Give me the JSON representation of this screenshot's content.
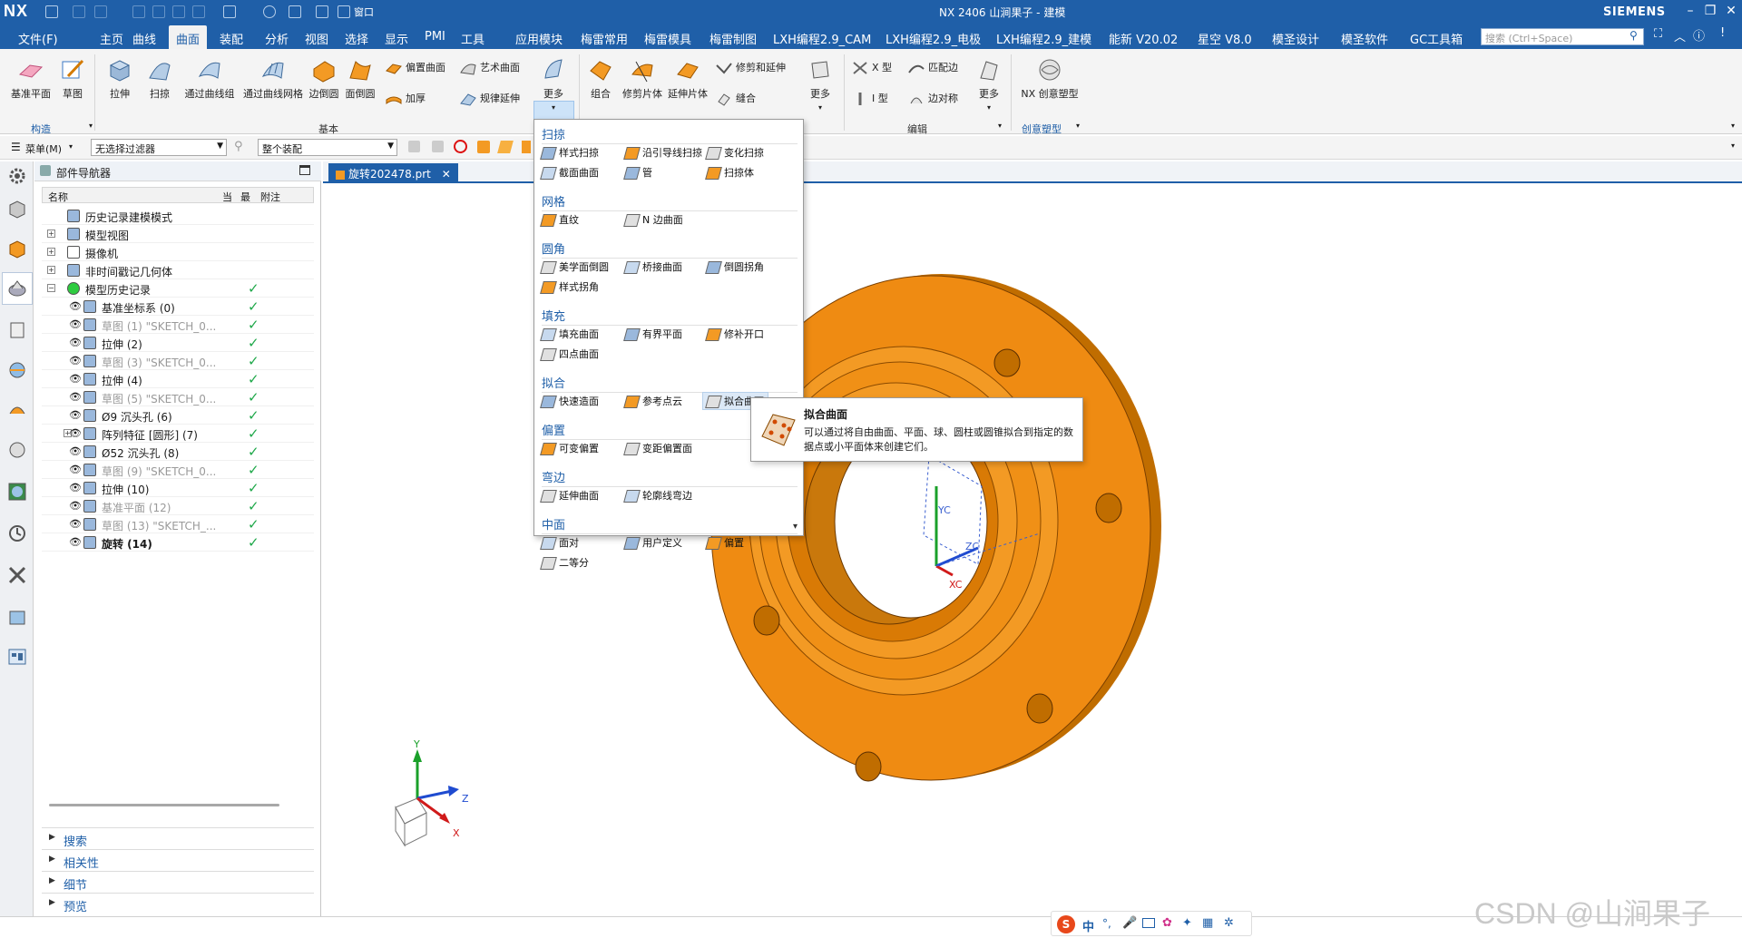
{
  "app": {
    "logo": "NX",
    "window_title": "NX 2406 山涧果子 - 建模",
    "brand": "SIEMENS",
    "window_label": "窗口"
  },
  "menubar": {
    "items": [
      "文件(F)",
      "主页",
      "曲线",
      "曲面",
      "装配",
      "分析",
      "视图",
      "选择",
      "显示",
      "PMI",
      "工具",
      "应用模块",
      "梅雷常用",
      "梅雷模具",
      "梅雷制图",
      "LXH编程2.9_CAM",
      "LXH编程2.9_电极",
      "LXH编程2.9_建模",
      "能新 V20.02",
      "星空 V8.0",
      "模圣设计",
      "模圣软件",
      "GC工具箱"
    ],
    "active": "曲面",
    "search_placeholder": "搜索 (Ctrl+Space)"
  },
  "ribbon": {
    "construct": [
      "基准平面",
      "草图"
    ],
    "basic_large": [
      "拉伸",
      "扫掠",
      "通过曲线组",
      "通过曲线网格",
      "边倒圆",
      "面倒圆"
    ],
    "basic_small": [
      "偏置曲面",
      "艺术曲面",
      "加厚",
      "规律延伸"
    ],
    "more": "更多",
    "edit_large": [
      "组合",
      "修剪片体",
      "延伸片体"
    ],
    "edit_small": [
      "修剪和延伸",
      "缝合"
    ],
    "more2": "更多",
    "edit_right": [
      "X 型",
      "I 型",
      "匹配边",
      "边对称"
    ],
    "more3": "更多",
    "creative": "NX 创意塑型",
    "group_labels": {
      "construct": "构造",
      "basic": "基本",
      "edit": "编辑",
      "creative": "创意塑型"
    }
  },
  "toolbar2": {
    "menu": "菜单(M)",
    "filter": "无选择过滤器",
    "assembly": "整个装配"
  },
  "navigator": {
    "title": "部件导航器",
    "columns": [
      "名称",
      "当",
      "最",
      "附注"
    ],
    "rows": [
      {
        "label": "历史记录建模模式",
        "check": ""
      },
      {
        "label": "模型视图",
        "check": ""
      },
      {
        "label": "摄像机",
        "check": ""
      },
      {
        "label": "非时间戳记几何体",
        "check": ""
      },
      {
        "label": "模型历史记录",
        "check": "✓"
      },
      {
        "label": "基准坐标系 (0)",
        "check": "✓"
      },
      {
        "label": "草图 (1) \"SKETCH_0...",
        "check": "✓"
      },
      {
        "label": "拉伸 (2)",
        "check": "✓"
      },
      {
        "label": "草图 (3) \"SKETCH_0...",
        "check": "✓"
      },
      {
        "label": "拉伸 (4)",
        "check": "✓"
      },
      {
        "label": "草图 (5) \"SKETCH_0...",
        "check": "✓"
      },
      {
        "label": "Ø9 沉头孔 (6)",
        "check": "✓"
      },
      {
        "label": "阵列特征 [圆形] (7)",
        "check": "✓"
      },
      {
        "label": "Ø52 沉头孔 (8)",
        "check": "✓"
      },
      {
        "label": "草图 (9) \"SKETCH_0...",
        "check": "✓"
      },
      {
        "label": "拉伸 (10)",
        "check": "✓"
      },
      {
        "label": "基准平面 (12)",
        "check": "✓"
      },
      {
        "label": "草图 (13) \"SKETCH_...",
        "check": "✓"
      },
      {
        "label": "旋转 (14)",
        "check": "✓"
      }
    ],
    "accordions": [
      "搜索",
      "相关性",
      "细节",
      "预览"
    ]
  },
  "document_tab": "旋转202478.prt",
  "dropdown": {
    "sections": [
      {
        "title": "扫掠",
        "items": [
          "样式扫掠",
          "沿引导线扫掠",
          "变化扫掠",
          "截面曲面",
          "管",
          "扫掠体"
        ]
      },
      {
        "title": "网格",
        "items": [
          "直纹",
          "N 边曲面"
        ]
      },
      {
        "title": "圆角",
        "items": [
          "美学面倒圆",
          "桥接曲面",
          "倒圆拐角",
          "样式拐角"
        ]
      },
      {
        "title": "填充",
        "items": [
          "填充曲面",
          "有界平面",
          "修补开口",
          "四点曲面"
        ]
      },
      {
        "title": "拟合",
        "items": [
          "快速造面",
          "参考点云",
          "拟合曲面"
        ]
      },
      {
        "title": "偏置",
        "items": [
          "可变偏置",
          "变距偏置面"
        ]
      },
      {
        "title": "弯边",
        "items": [
          "延伸曲面",
          "轮廓线弯边"
        ]
      },
      {
        "title": "中面",
        "items": [
          "面对",
          "用户定义",
          "偏置",
          "二等分"
        ]
      }
    ]
  },
  "tooltip": {
    "title": "拟合曲面",
    "description": "可以通过将自由曲面、平面、球、圆柱或圆锥拟合到指定的数据点或小平面体来创建它们。"
  },
  "viewport": {
    "csys_labels": [
      "YC",
      "ZC",
      "XC"
    ],
    "triad_labels": [
      "Y",
      "Z",
      "X"
    ]
  },
  "ime": {
    "lang": "中"
  },
  "watermark": "CSDN @山涧果子",
  "colors": {
    "accent": "#1f5fa8",
    "part_orange": "#f08c10",
    "check_green": "#1fa84a"
  }
}
